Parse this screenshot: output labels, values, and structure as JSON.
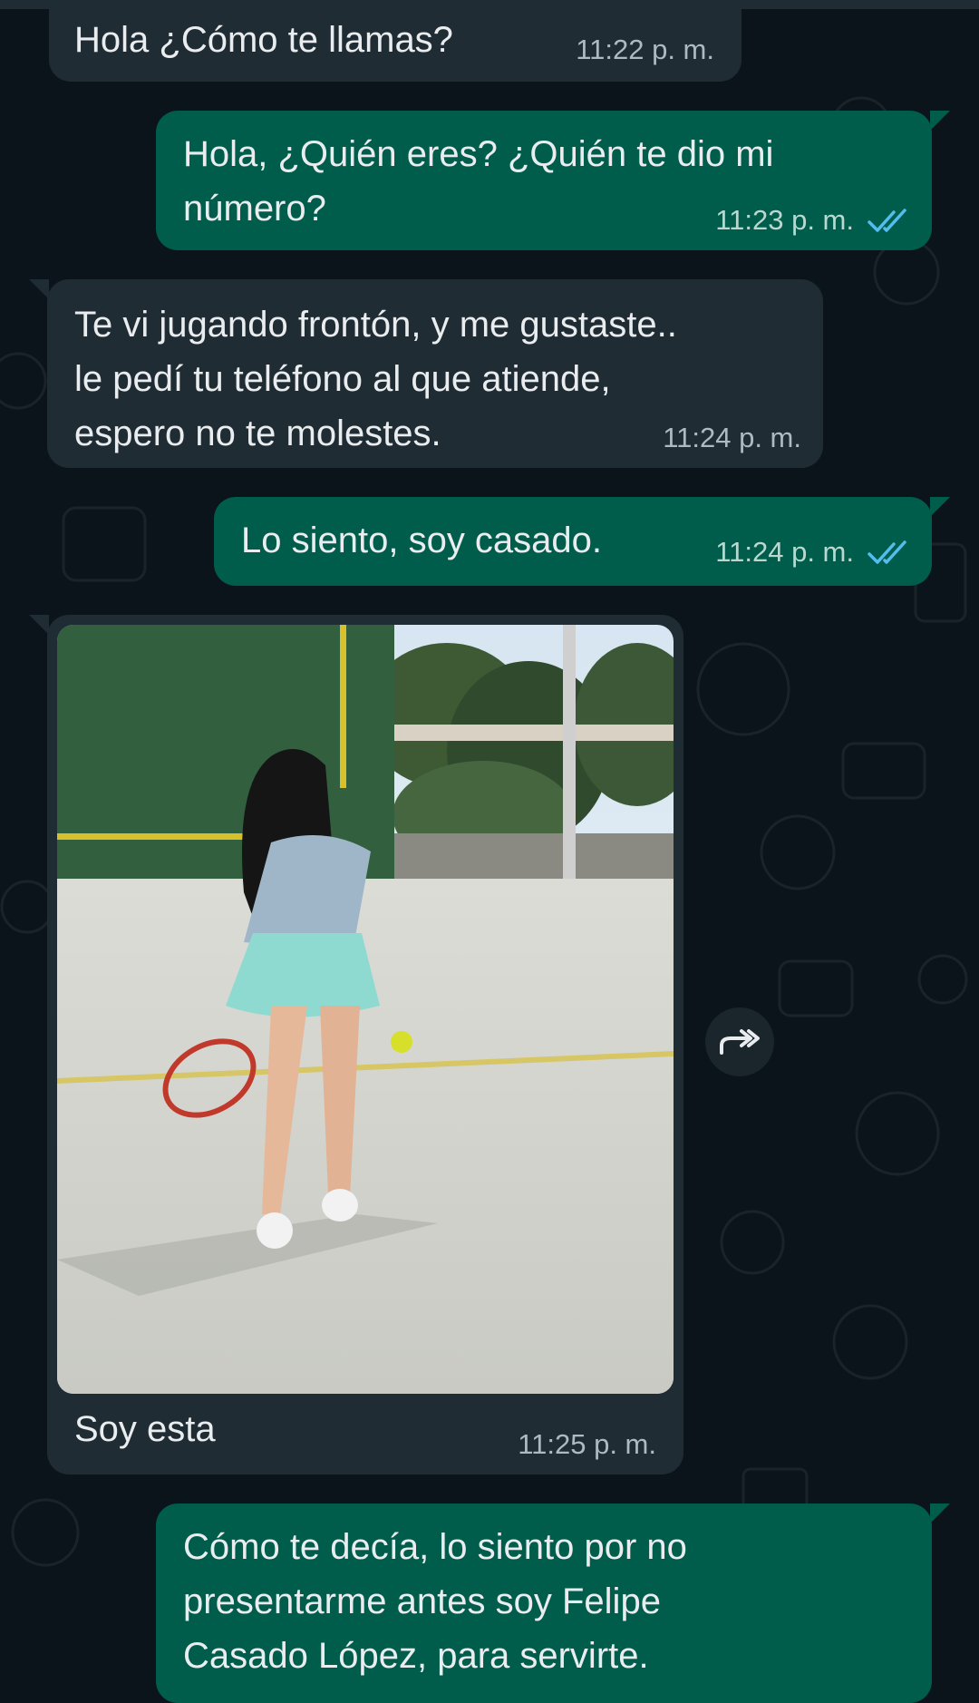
{
  "colors": {
    "background": "#0b141a",
    "incoming_bubble": "#202c33",
    "outgoing_bubble": "#005c4b",
    "message_text": "#e9edef",
    "read_receipt": "#53bdeb"
  },
  "messages": [
    {
      "direction": "incoming",
      "text": "Hola ¿Cómo te llamas?",
      "time": "11:22 p. m."
    },
    {
      "direction": "outgoing",
      "text": "Hola, ¿Quién eres? ¿Quién te dio mi\nnúmero?",
      "time": "11:23 p. m.",
      "status": "read-double-check-icon"
    },
    {
      "direction": "incoming",
      "text": "Te vi jugando frontón, y me gustaste..\nle pedí tu teléfono al que atiende,\nespero no te molestes.",
      "time": "11:24 p. m."
    },
    {
      "direction": "outgoing",
      "text": "Lo siento, soy casado.",
      "time": "11:24 p. m.",
      "status": "read-double-check-icon"
    },
    {
      "direction": "incoming",
      "type": "image",
      "caption": "Soy esta",
      "time": "11:25 p. m."
    },
    {
      "direction": "outgoing",
      "text": "Cómo te decía, lo siento por no\npresentarme antes soy Felipe\nCasado López, para servirte."
    }
  ],
  "forward_button": {
    "icon": "forward-arrow-icon"
  }
}
